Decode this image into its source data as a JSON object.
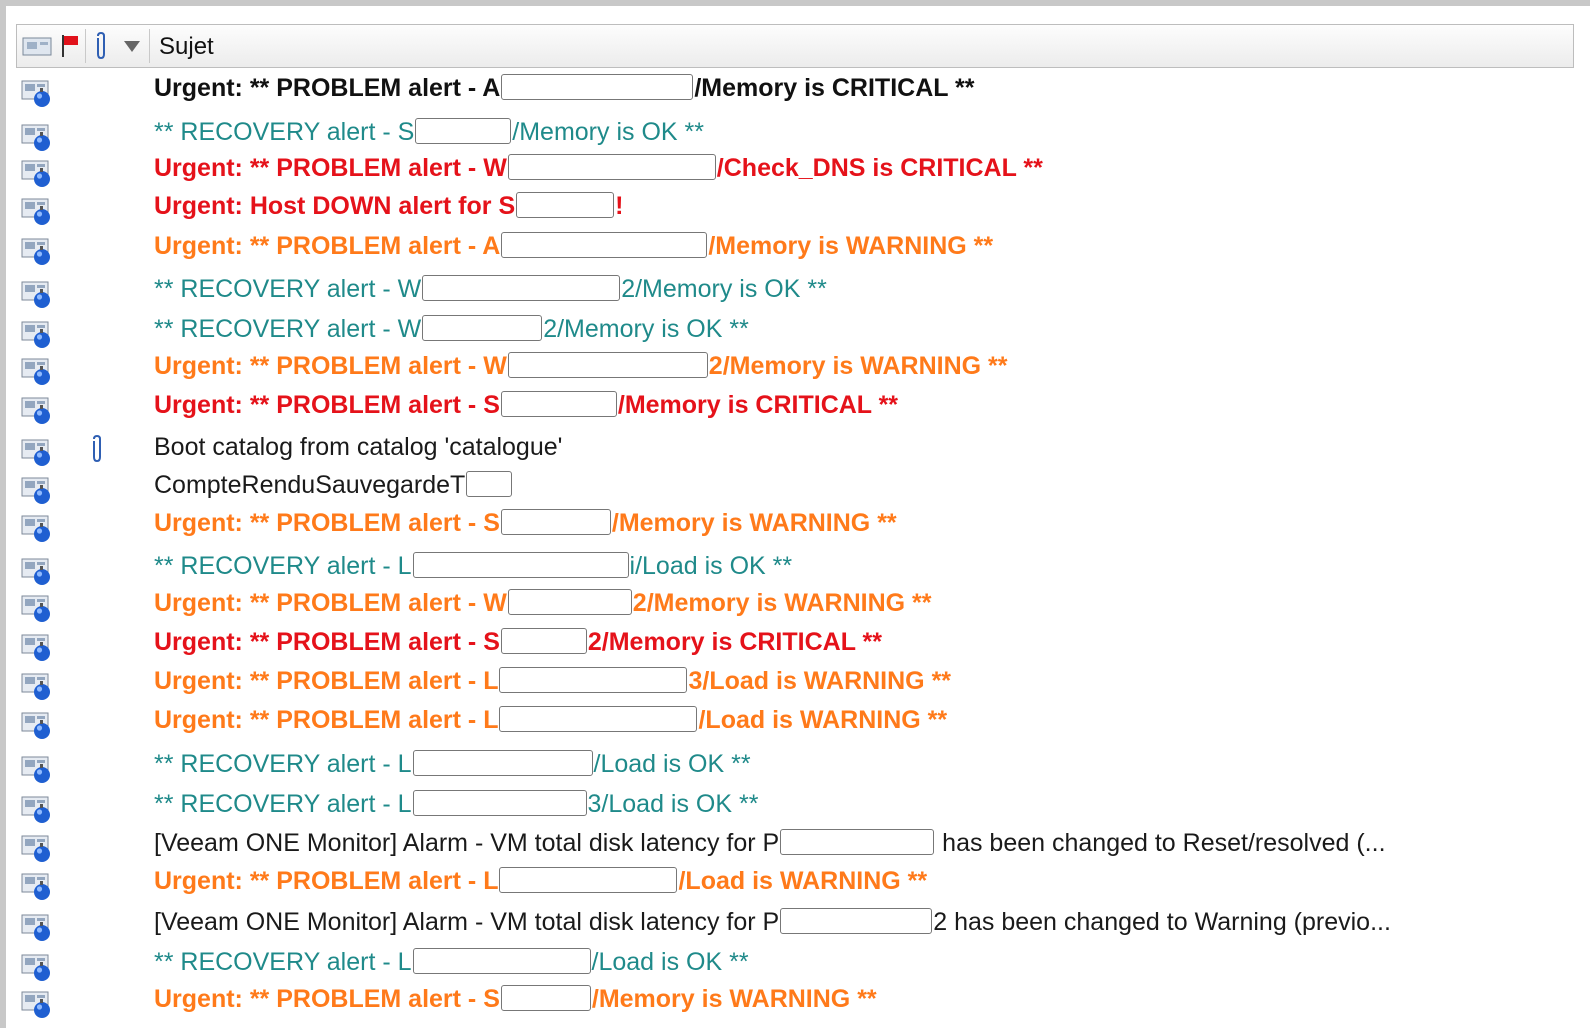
{
  "header": {
    "subject_label": "Sujet"
  },
  "colors": {
    "critical": "#e5121a",
    "warning": "#ff7a1a",
    "recovery": "#1f8a8a",
    "normal": "#1a1a1a"
  },
  "icons": {
    "row": "envelope-status-icon",
    "attachment": "paperclip-icon",
    "flag": "flag-icon",
    "sort": "sort-descending-icon"
  },
  "rows": [
    {
      "prefix": "Urgent:  ** PROBLEM alert - A",
      "suffix": "/Memory is CRITICAL **",
      "style": "dark",
      "redact_w": 190
    },
    {
      "prefix": "** RECOVERY alert - S",
      "suffix": "/Memory is OK **",
      "style": "ok",
      "redact_w": 94
    },
    {
      "prefix": "Urgent:  ** PROBLEM alert - W",
      "suffix": "/Check_DNS is CRITICAL **",
      "style": "crit",
      "redact_w": 206
    },
    {
      "prefix": "Urgent:  Host DOWN alert for S",
      "suffix": "!",
      "style": "crit",
      "redact_w": 96
    },
    {
      "prefix": "Urgent:  ** PROBLEM alert - A",
      "suffix": "/Memory is WARNING **",
      "style": "warn",
      "redact_w": 204
    },
    {
      "prefix": "** RECOVERY alert - W",
      "suffix": "2/Memory is OK **",
      "style": "ok",
      "redact_w": 196
    },
    {
      "prefix": "** RECOVERY alert - W",
      "suffix": "2/Memory is OK **",
      "style": "ok",
      "redact_w": 118
    },
    {
      "prefix": "Urgent:  ** PROBLEM alert - W",
      "suffix": "2/Memory is WARNING **",
      "style": "warn",
      "redact_w": 198
    },
    {
      "prefix": "Urgent:  ** PROBLEM alert - S",
      "suffix": "/Memory is CRITICAL **",
      "style": "crit",
      "redact_w": 114
    },
    {
      "prefix": "Boot catalog from catalog 'catalogue'",
      "suffix": "",
      "style": "norm",
      "redact_w": 0,
      "attachment": true
    },
    {
      "prefix": "CompteRenduSauvegardeT",
      "suffix": "",
      "style": "norm",
      "redact_w": 44
    },
    {
      "prefix": "Urgent:  ** PROBLEM alert - S",
      "suffix": "/Memory is WARNING **",
      "style": "warn",
      "redact_w": 108
    },
    {
      "prefix": "** RECOVERY alert - L",
      "suffix": "i/Load is OK **",
      "style": "ok",
      "redact_w": 214
    },
    {
      "prefix": "Urgent:  ** PROBLEM alert - W",
      "suffix": "2/Memory is WARNING **",
      "style": "warn",
      "redact_w": 122
    },
    {
      "prefix": "Urgent:  ** PROBLEM alert - S",
      "suffix": "2/Memory is CRITICAL **",
      "style": "crit",
      "redact_w": 84
    },
    {
      "prefix": "Urgent:  ** PROBLEM alert - L",
      "suffix": "3/Load is WARNING **",
      "style": "warn",
      "redact_w": 186
    },
    {
      "prefix": "Urgent:  ** PROBLEM alert - L",
      "suffix": "/Load is WARNING **",
      "style": "warn",
      "redact_w": 196
    },
    {
      "prefix": "** RECOVERY alert - L",
      "suffix": "/Load is OK **",
      "style": "ok",
      "redact_w": 178
    },
    {
      "prefix": "** RECOVERY alert - L",
      "suffix": "3/Load is OK **",
      "style": "ok",
      "redact_w": 172
    },
    {
      "prefix": "[Veeam ONE Monitor] Alarm - VM total disk latency for P",
      "suffix": " has been changed to Reset/resolved (...",
      "style": "norm",
      "redact_w": 152
    },
    {
      "prefix": "Urgent:  ** PROBLEM alert - L",
      "suffix": "/Load is WARNING **",
      "style": "warn",
      "redact_w": 176
    },
    {
      "prefix": "[Veeam ONE Monitor] Alarm - VM total disk latency for P",
      "suffix": "2 has been changed to Warning (previo...",
      "style": "norm",
      "redact_w": 150
    },
    {
      "prefix": "** RECOVERY alert - L",
      "suffix": "/Load is OK **",
      "style": "ok",
      "redact_w": 176
    },
    {
      "prefix": "Urgent:  ** PROBLEM alert - S",
      "suffix": "/Memory is WARNING **",
      "style": "warn",
      "redact_w": 88
    }
  ]
}
